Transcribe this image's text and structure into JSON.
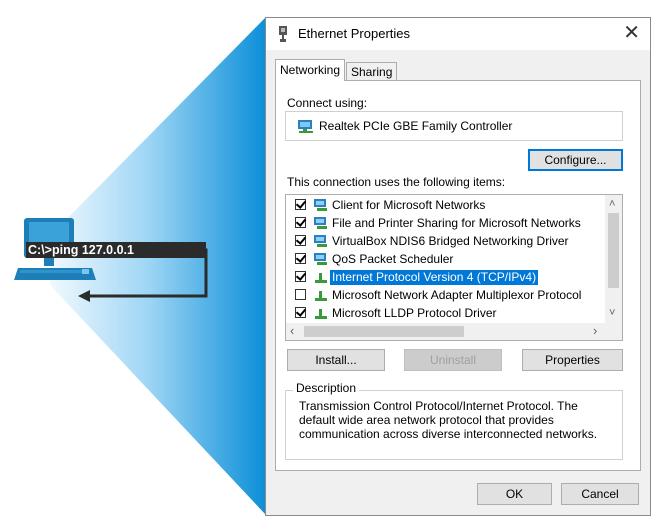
{
  "illustration": {
    "command": "C:\\>ping 127.0.0.1"
  },
  "dialog": {
    "title": "Ethernet Properties",
    "close_glyph": "✕",
    "tabs": [
      {
        "label": "Networking",
        "active": true
      },
      {
        "label": "Sharing",
        "active": false
      }
    ],
    "connect_using_label": "Connect using:",
    "adapter_name": "Realtek PCIe GBE Family Controller",
    "configure_label": "Configure...",
    "items_label": "This connection uses the following items:",
    "items": [
      {
        "label": "Client for Microsoft Networks",
        "checked": true,
        "icon": "network-client-icon",
        "selected": false
      },
      {
        "label": "File and Printer Sharing for Microsoft Networks",
        "checked": true,
        "icon": "network-service-icon",
        "selected": false
      },
      {
        "label": "VirtualBox NDIS6 Bridged Networking Driver",
        "checked": true,
        "icon": "network-driver-icon",
        "selected": false
      },
      {
        "label": "QoS Packet Scheduler",
        "checked": true,
        "icon": "network-service-icon",
        "selected": false
      },
      {
        "label": "Internet Protocol Version 4 (TCP/IPv4)",
        "checked": true,
        "icon": "protocol-icon",
        "selected": true
      },
      {
        "label": "Microsoft Network Adapter Multiplexor Protocol",
        "checked": false,
        "icon": "protocol-icon",
        "selected": false
      },
      {
        "label": "Microsoft LLDP Protocol Driver",
        "checked": true,
        "icon": "protocol-icon",
        "selected": false
      }
    ],
    "install_label": "Install...",
    "uninstall_label": "Uninstall",
    "properties_label": "Properties",
    "description_title": "Description",
    "description_text": "Transmission Control Protocol/Internet Protocol. The default wide area network protocol that provides communication across diverse interconnected networks.",
    "ok_label": "OK",
    "cancel_label": "Cancel"
  },
  "colors": {
    "selection": "#0078d7",
    "beam_light": "#e6f4fc",
    "beam_dark": "#0b8fd8",
    "computer": "#1e7fb8"
  }
}
